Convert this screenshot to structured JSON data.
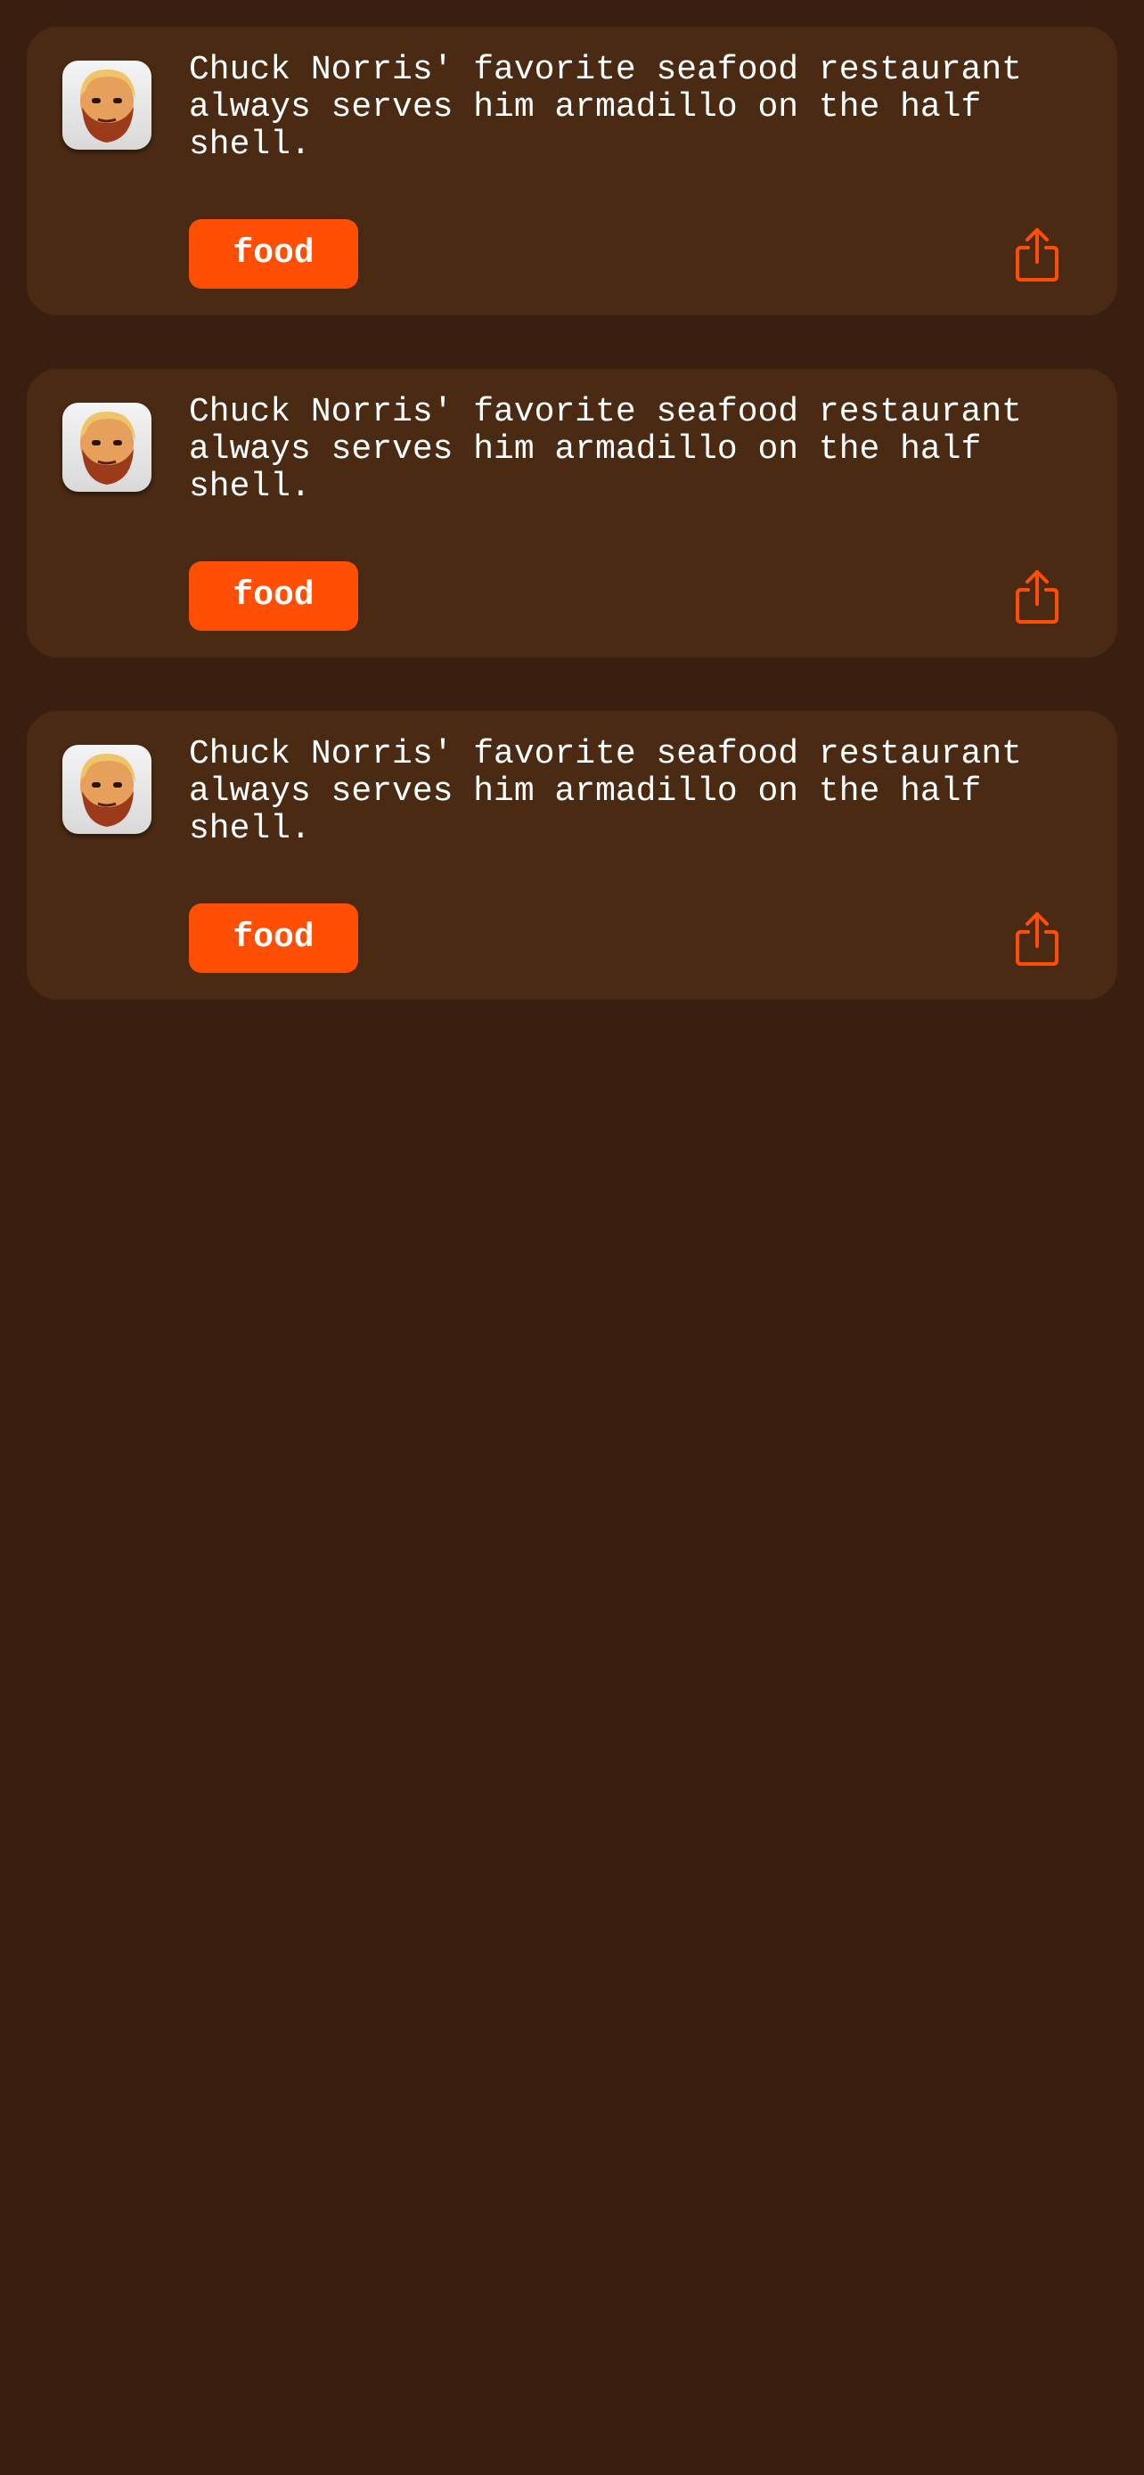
{
  "jokes": [
    {
      "text": "Chuck Norris' favorite seafood restaurant always serves him armadillo on the half shell.",
      "category": "food",
      "avatar_icon": "chuck-norris-avatar-icon",
      "share_icon": "share-icon"
    },
    {
      "text": "Chuck Norris' favorite seafood restaurant always serves him armadillo on the half shell.",
      "category": "food",
      "avatar_icon": "chuck-norris-avatar-icon",
      "share_icon": "share-icon"
    },
    {
      "text": "Chuck Norris' favorite seafood restaurant always serves him armadillo on the half shell.",
      "category": "food",
      "avatar_icon": "chuck-norris-avatar-icon",
      "share_icon": "share-icon"
    }
  ],
  "colors": {
    "background": "#3a1f10",
    "card": "#4a2a12",
    "accent": "#ff4f05",
    "text": "#ffffff"
  }
}
